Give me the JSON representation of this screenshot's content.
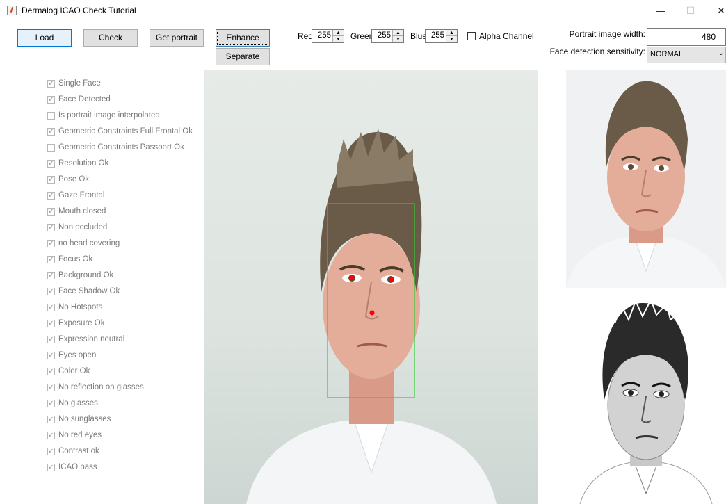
{
  "window": {
    "title": "Dermalog ICAO Check Tutorial",
    "minimize": "—",
    "maximize": "☐",
    "close": "✕"
  },
  "toolbar": {
    "load": "Load",
    "check": "Check",
    "get_portrait": "Get portrait",
    "enhance": "Enhance",
    "separate": "Separate"
  },
  "color": {
    "red_label": "Red",
    "red_value": "255",
    "green_label": "Green",
    "green_value": "255",
    "blue_label": "Blue",
    "blue_value": "255",
    "alpha_label": "Alpha Channel"
  },
  "settings": {
    "portrait_width_label": "Portrait image width:",
    "portrait_width_value": "480",
    "sensitivity_label": "Face detection sensitivity:",
    "sensitivity_value": "NORMAL"
  },
  "checks": [
    {
      "label": "Single Face",
      "checked": true
    },
    {
      "label": "Face Detected",
      "checked": true
    },
    {
      "label": "Is portrait image interpolated",
      "checked": false
    },
    {
      "label": "Geometric Constraints Full Frontal Ok",
      "checked": true
    },
    {
      "label": "Geometric Constraints Passport Ok",
      "checked": false
    },
    {
      "label": "Resolution Ok",
      "checked": true
    },
    {
      "label": "Pose Ok",
      "checked": true
    },
    {
      "label": "Gaze Frontal",
      "checked": true
    },
    {
      "label": "Mouth closed",
      "checked": true
    },
    {
      "label": "Non occluded",
      "checked": true
    },
    {
      "label": "no head covering",
      "checked": true
    },
    {
      "label": "Focus Ok",
      "checked": true
    },
    {
      "label": "Background Ok",
      "checked": true
    },
    {
      "label": "Face Shadow Ok",
      "checked": true
    },
    {
      "label": "No Hotspots",
      "checked": true
    },
    {
      "label": "Exposure Ok",
      "checked": true
    },
    {
      "label": "Expression neutral",
      "checked": true
    },
    {
      "label": "Eyes open",
      "checked": true
    },
    {
      "label": "Color Ok",
      "checked": true
    },
    {
      "label": "No reflection on glasses",
      "checked": true
    },
    {
      "label": "No glasses",
      "checked": true
    },
    {
      "label": "No sunglasses",
      "checked": true
    },
    {
      "label": "No red eyes",
      "checked": true
    },
    {
      "label": "Contrast ok",
      "checked": true
    },
    {
      "label": "ICAO pass",
      "checked": true
    }
  ],
  "colors": {
    "face_box": "#33cc33",
    "landmark": "#ff0000",
    "accent": "#0078d7"
  }
}
